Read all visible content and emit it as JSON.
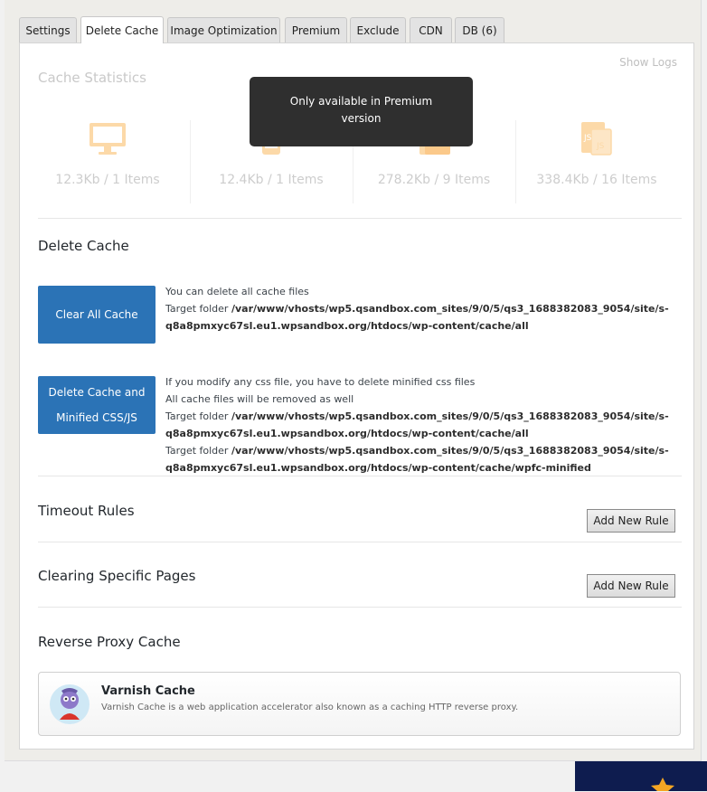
{
  "tabs": [
    {
      "label": "Settings"
    },
    {
      "label": "Delete Cache"
    },
    {
      "label": "Image Optimization"
    },
    {
      "label": "Premium"
    },
    {
      "label": "Exclude"
    },
    {
      "label": "CDN"
    },
    {
      "label": "DB (6)"
    }
  ],
  "active_tab": "Delete Cache",
  "cache_statistics": {
    "title": "Cache Statistics",
    "show_logs": "Show Logs",
    "items": [
      {
        "icon": "desktop-icon",
        "value": "12.3Kb / 1 Items"
      },
      {
        "icon": "mobile-icon",
        "value": "12.4Kb / 1 Items"
      },
      {
        "icon": "css-file-icon",
        "value": "278.2Kb / 9 Items"
      },
      {
        "icon": "js-file-icon",
        "value": "338.4Kb / 16 Items"
      }
    ],
    "tooltip": "Only available in Premium version"
  },
  "delete_cache": {
    "title": "Delete Cache",
    "clear_all_button": "Clear All Cache",
    "clear_all_desc": "You can delete all cache files",
    "target_folder_label": "Target folder",
    "clear_all_path": "/var/www/vhosts/wp5.qsandbox.com_sites/9/0/5/qs3_1688382083_9054/site/s-q8a8pmxyc67sl.eu1.wpsandbox.org/htdocs/wp-content/cache/all",
    "minified_button": "Delete Cache and Minified CSS/JS",
    "minified_desc1": "If you modify any css file, you have to delete minified css files",
    "minified_desc2": "All cache files will be removed as well",
    "minified_path1": "/var/www/vhosts/wp5.qsandbox.com_sites/9/0/5/qs3_1688382083_9054/site/s-q8a8pmxyc67sl.eu1.wpsandbox.org/htdocs/wp-content/cache/all",
    "minified_path2": "/var/www/vhosts/wp5.qsandbox.com_sites/9/0/5/qs3_1688382083_9054/site/s-q8a8pmxyc67sl.eu1.wpsandbox.org/htdocs/wp-content/cache/wpfc-minified"
  },
  "timeout_rules": {
    "title": "Timeout Rules",
    "button": "Add New Rule"
  },
  "clearing_pages": {
    "title": "Clearing Specific Pages",
    "button": "Add New Rule"
  },
  "reverse_proxy": {
    "title": "Reverse Proxy Cache",
    "varnish_title": "Varnish Cache",
    "varnish_desc": "Varnish Cache is a web application accelerator also known as a caching HTTP reverse proxy."
  },
  "colors": {
    "primary_button": "#2b73b6",
    "stat_icon": "#fcd9a8",
    "tooltip_bg": "#2f2f2f"
  }
}
